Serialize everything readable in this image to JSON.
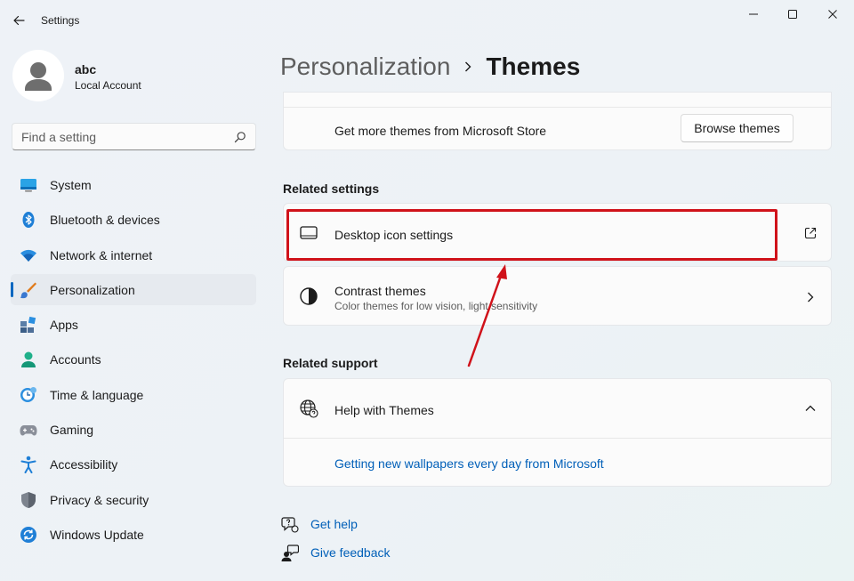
{
  "window": {
    "title": "Settings",
    "controls": {
      "minimize": "minimize",
      "maximize": "maximize",
      "close": "close"
    }
  },
  "profile": {
    "name": "abc",
    "account_type": "Local Account"
  },
  "search": {
    "placeholder": "Find a setting",
    "value": ""
  },
  "sidebar": {
    "items": [
      {
        "label": "System",
        "icon": "system-icon"
      },
      {
        "label": "Bluetooth & devices",
        "icon": "bluetooth-icon"
      },
      {
        "label": "Network & internet",
        "icon": "wifi-icon"
      },
      {
        "label": "Personalization",
        "icon": "brush-icon",
        "selected": true
      },
      {
        "label": "Apps",
        "icon": "apps-icon"
      },
      {
        "label": "Accounts",
        "icon": "accounts-icon"
      },
      {
        "label": "Time & language",
        "icon": "globe-clock-icon"
      },
      {
        "label": "Gaming",
        "icon": "gamepad-icon"
      },
      {
        "label": "Accessibility",
        "icon": "accessibility-icon"
      },
      {
        "label": "Privacy & security",
        "icon": "shield-icon"
      },
      {
        "label": "Windows Update",
        "icon": "update-icon"
      }
    ]
  },
  "breadcrumb": {
    "parent": "Personalization",
    "current": "Themes"
  },
  "store": {
    "text": "Get more themes from Microsoft Store",
    "button_label": "Browse themes"
  },
  "related_settings": {
    "heading": "Related settings",
    "items": [
      {
        "title": "Desktop icon settings",
        "subtitle": "",
        "icon": "monitor-icon",
        "action_icon": "open-external-icon"
      },
      {
        "title": "Contrast themes",
        "subtitle": "Color themes for low vision, light sensitivity",
        "icon": "contrast-icon",
        "action_icon": "chevron-right-icon"
      }
    ]
  },
  "related_support": {
    "heading": "Related support",
    "help_title": "Help with Themes",
    "links": [
      "Getting new wallpapers every day from Microsoft"
    ]
  },
  "footer_links": [
    {
      "label": "Get help",
      "icon": "help-icon"
    },
    {
      "label": "Give feedback",
      "icon": "feedback-icon"
    }
  ],
  "colors": {
    "accent": "#0067c0",
    "link": "#005fb8",
    "annotation": "#d0121a",
    "background": "#eef2f7",
    "card": "#fbfbfb"
  }
}
